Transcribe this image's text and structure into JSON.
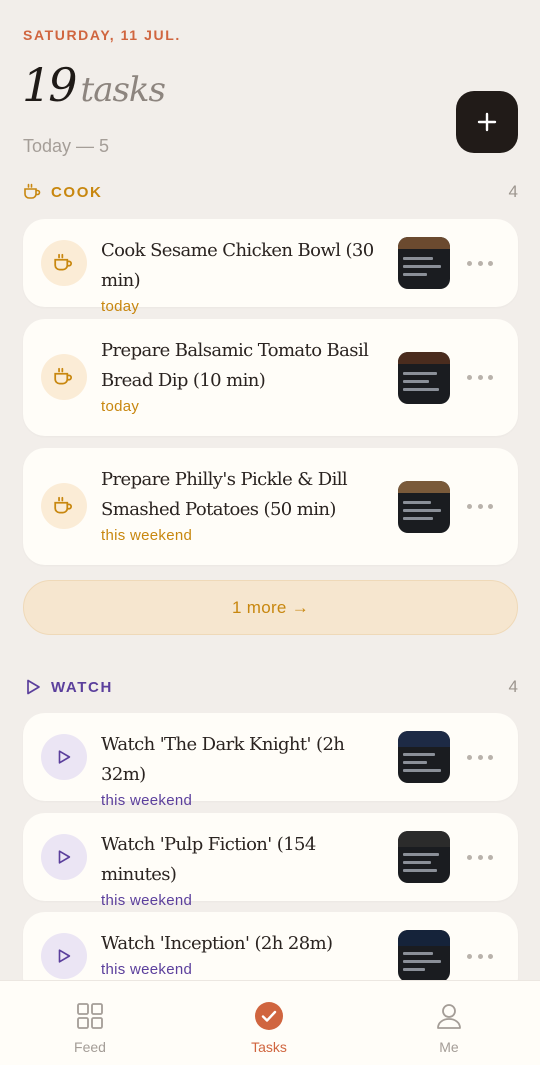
{
  "header": {
    "date": "SATURDAY, 11 JUL.",
    "task_count": "19",
    "task_word": "tasks",
    "today_line": "Today — 5"
  },
  "sections": {
    "cook": {
      "label": "COOK",
      "count": "4",
      "icon": "cup-icon",
      "color": "#c8870f",
      "items": [
        {
          "title": "Cook Sesame Chicken Bowl (30 min)",
          "when": "today"
        },
        {
          "title": "Prepare Balsamic Tomato Basil Bread Dip (10 min)",
          "when": "today"
        },
        {
          "title": "Prepare Philly's Pickle & Dill Smashed Potatoes (50 min)",
          "when": "this weekend"
        }
      ],
      "more_label": "1 more →"
    },
    "watch": {
      "label": "WATCH",
      "count": "4",
      "icon": "play-icon",
      "color": "#5b3f9c",
      "items": [
        {
          "title": "Watch 'The Dark Knight' (2h 32m)",
          "when": "this weekend"
        },
        {
          "title": "Watch 'Pulp Fiction' (154 minutes)",
          "when": "this weekend"
        },
        {
          "title": "Watch 'Inception' (2h 28m)",
          "when": "this weekend"
        }
      ]
    }
  },
  "tabbar": {
    "tabs": [
      {
        "label": "Feed",
        "icon": "grid-icon",
        "active": false
      },
      {
        "label": "Tasks",
        "icon": "check-circle-icon",
        "active": true
      },
      {
        "label": "Me",
        "icon": "person-icon",
        "active": false
      }
    ]
  },
  "colors": {
    "accent": "#d0653f",
    "cook": "#c8870f",
    "watch": "#5b3f9c",
    "background": "#f2eeea",
    "card": "#fffdf8"
  }
}
